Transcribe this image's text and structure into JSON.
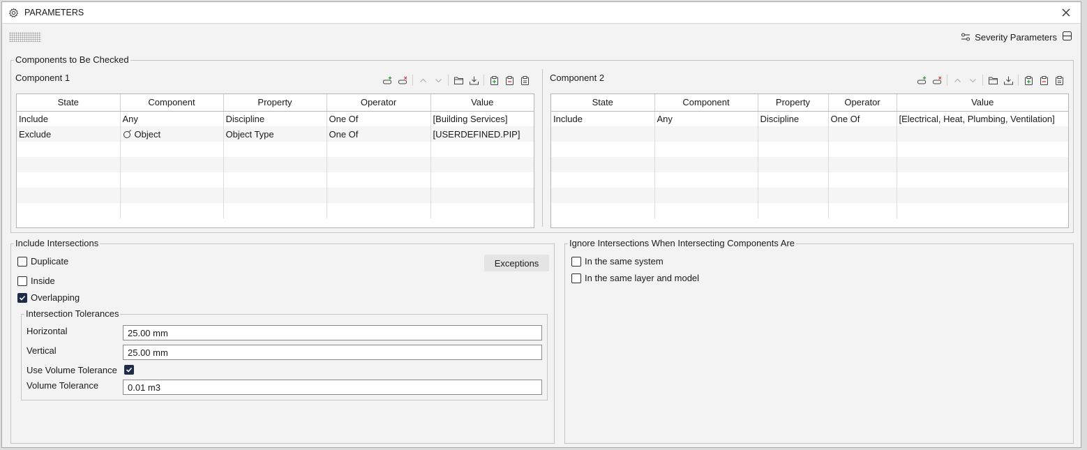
{
  "window": {
    "title": "PARAMETERS"
  },
  "header": {
    "severity_label": "Severity Parameters"
  },
  "components_group": {
    "legend": "Components to Be Checked"
  },
  "component1": {
    "title": "Component 1",
    "columns": [
      "State",
      "Component",
      "Property",
      "Operator",
      "Value"
    ],
    "rows": [
      [
        "Include",
        "Any",
        "Discipline",
        "One Of",
        "[Building Services]"
      ],
      [
        "Exclude",
        "Object",
        "Object Type",
        "One Of",
        "[USERDEFINED.PIP]"
      ]
    ]
  },
  "component2": {
    "title": "Component 2",
    "columns": [
      "State",
      "Component",
      "Property",
      "Operator",
      "Value"
    ],
    "rows": [
      [
        "Include",
        "Any",
        "Discipline",
        "One Of",
        "[Electrical, Heat, Plumbing, Ventilation]"
      ]
    ]
  },
  "include_group": {
    "legend": "Include Intersections",
    "duplicate": {
      "label": "Duplicate",
      "checked": false
    },
    "inside": {
      "label": "Inside",
      "checked": false
    },
    "overlapping": {
      "label": "Overlapping",
      "checked": true
    },
    "exceptions_label": "Exceptions",
    "tolerances": {
      "legend": "Intersection Tolerances",
      "horizontal_label": "Horizontal",
      "horizontal_value": "25.00 mm",
      "vertical_label": "Vertical",
      "vertical_value": "25.00 mm",
      "use_volume_label": "Use Volume Tolerance",
      "use_volume_checked": true,
      "volume_label": "Volume Tolerance",
      "volume_value": "0.01 m3"
    }
  },
  "ignore_group": {
    "legend": "Ignore Intersections When Intersecting Components Are",
    "same_system": {
      "label": "In the same system",
      "checked": false
    },
    "same_layer": {
      "label": "In the same layer and model",
      "checked": false
    }
  },
  "colors": {
    "accent_check": "#1e2c4a",
    "add_green": "#2e9e3e",
    "remove_red": "#d23a3a"
  }
}
